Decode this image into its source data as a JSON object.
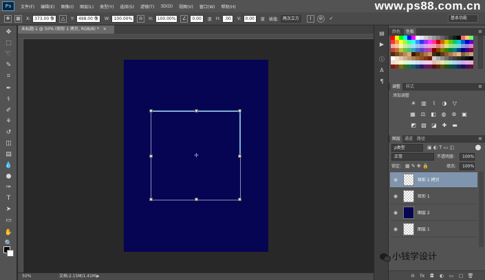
{
  "app": {
    "logo": "Ps",
    "menu": [
      "文件(F)",
      "编辑(E)",
      "图像(I)",
      "图层(L)",
      "类型(Y)",
      "选择(S)",
      "滤镜(T)",
      "3D(D)",
      "视图(V)",
      "窗口(W)",
      "帮助(H)"
    ],
    "watermark": "www.ps88.com.cn"
  },
  "options": {
    "x_label": "X:",
    "x_value": "373.00 像",
    "y_label": "Y:",
    "y_value": "498.00 像",
    "w_label": "W:",
    "w_value": "100.00%",
    "h_label": "H:",
    "h_value": "100.00%",
    "angle_value": "0.00",
    "angle_unit": "度",
    "hskew_label": "H:",
    "hskew_value": ".00",
    "vskew_label": "V:",
    "vskew_value": "0.00",
    "skew_unit": "度",
    "interp_label": "插值:",
    "interp_value": "两次立方",
    "cancel_icon": "cancel-icon",
    "commit_icon": "check-icon",
    "preset": "基本功能"
  },
  "document": {
    "tab_title": "未标题-1 @ 50% (矩形 1 拷贝, RGB/8) *",
    "tab_close": "×",
    "canvas_color": "#060553",
    "zoom": "50%",
    "doc_info": "文档:2.15M/1.41M",
    "status_arrow": "▶"
  },
  "tools": [
    "move-tool",
    "marquee-tool",
    "lasso-tool",
    "quick-select-tool",
    "crop-tool",
    "eyedropper-tool",
    "healing-brush-tool",
    "brush-tool",
    "clone-stamp-tool",
    "history-brush-tool",
    "eraser-tool",
    "gradient-tool",
    "blur-tool",
    "dodge-tool",
    "pen-tool",
    "type-tool",
    "path-select-tool",
    "rectangle-tool",
    "hand-tool",
    "zoom-tool"
  ],
  "tool_glyphs": [
    "✥",
    "⬚",
    "➰",
    "✎",
    "⌗",
    "✒",
    "⚕",
    "✐",
    "⚘",
    "↺",
    "◫",
    "▤",
    "💧",
    "●",
    "✑",
    "T",
    "➤",
    "▭",
    "✋",
    "🔍"
  ],
  "swatches_panel": {
    "tabs": [
      "颜色",
      "色板"
    ],
    "active": 1,
    "colors": [
      "#ff0000",
      "#ffff00",
      "#00ff00",
      "#00ffff",
      "#0000ff",
      "#ff00ff",
      "#ffffff",
      "#e6e6e6",
      "#cccccc",
      "#b3b3b3",
      "#999999",
      "#808080",
      "#666666",
      "#4d4d4d",
      "#333333",
      "#1a1a1a",
      "#000000",
      "#ff6666",
      "#ffcc66",
      "#66ff66",
      "#ff3333",
      "#ff9933",
      "#ffff33",
      "#99ff33",
      "#33ff99",
      "#33ffff",
      "#3399ff",
      "#3333ff",
      "#9933ff",
      "#ff33ff",
      "#ff3399",
      "#cc0000",
      "#cc6600",
      "#cccc00",
      "#66cc00",
      "#00cc66",
      "#00cccc",
      "#0066cc",
      "#0000cc",
      "#6600cc",
      "#f4a6a6",
      "#f7c6a0",
      "#faf3a0",
      "#c8eba0",
      "#a0e6c0",
      "#a0e0f0",
      "#a0c0f0",
      "#b0a0f0",
      "#d8a0f0",
      "#f0a0d8",
      "#f0a0b0",
      "#e08080",
      "#e0b080",
      "#e0e080",
      "#a0e080",
      "#80e0b0",
      "#80d0e0",
      "#80a0e0",
      "#a080e0",
      "#e080c0",
      "#c04040",
      "#c07040",
      "#c0c040",
      "#70c040",
      "#40c080",
      "#40a0c0",
      "#4070c0",
      "#6040c0",
      "#a040c0",
      "#c04090",
      "#800000",
      "#804000",
      "#808000",
      "#408000",
      "#008040",
      "#008080",
      "#004080",
      "#000080",
      "#400080",
      "#800040",
      "#5a2a00",
      "#7a4a1a",
      "#9a6a3a",
      "#ba8a5a",
      "#d8aa7a",
      "#3a1a00",
      "#6a3a10",
      "#8a5a2a",
      "#aa7a4a",
      "#c89a6a",
      "#4a2a10",
      "#2a1a0a",
      "#603818",
      "#905830",
      "#b07848",
      "#d09868",
      "#e8b888",
      "#806040",
      "#a08060",
      "#c0a080",
      "#ffffff",
      "#f0e0d0",
      "#e0c8b0",
      "#d0b090",
      "#c09870",
      "#b08050",
      "#a06838",
      "#905020",
      "#803810",
      "#702000",
      "#cfcfcf",
      "#b0b0b0",
      "#909090",
      "#707070",
      "#505050",
      "#404040",
      "#303030",
      "#202020",
      "#101010",
      "#000000",
      "#f8d8d8",
      "#f8e8d0",
      "#f8f8d0",
      "#e0f8d0",
      "#d0f8e8",
      "#d0f0f8",
      "#d0e0f8",
      "#e0d0f8",
      "#f0d0f8",
      "#f8d0e8",
      "#e8b8b8",
      "#e8d0b0",
      "#e8e8b0",
      "#c8e8b0",
      "#b0e8d0",
      "#b0d8e8",
      "#b0c8e8",
      "#c8b0e8",
      "#e0b0e8",
      "#e8b0d0",
      "#7a1a1a",
      "#7a3a1a",
      "#7a6a1a",
      "#3a6a1a",
      "#1a6a4a",
      "#1a5a6a",
      "#1a3a6a",
      "#2a1a6a",
      "#5a1a6a",
      "#6a1a4a",
      "#5a1010",
      "#5a2810",
      "#5a5010",
      "#285010",
      "#10503a",
      "#10445a",
      "#102a5a",
      "#20105a",
      "#42105a",
      "#5a1036"
    ]
  },
  "adjustments_panel": {
    "tabs": [
      "调整",
      "样式"
    ],
    "active": 0,
    "title": "添加调整",
    "rows": [
      [
        "brightness-icon",
        "levels-icon",
        "curves-icon",
        "exposure-icon",
        "vibrance-icon"
      ],
      [
        "hue-saturation-icon",
        "color-balance-icon",
        "black-white-icon",
        "photo-filter-icon",
        "channel-mixer-icon",
        "color-lookup-icon"
      ],
      [
        "invert-icon",
        "posterize-icon",
        "threshold-icon",
        "selective-color-icon",
        "gradient-map-icon"
      ]
    ],
    "glyphs": [
      [
        "☀",
        "▥",
        "⌇",
        "◑",
        "▽"
      ],
      [
        "▦",
        "⚖",
        "◧",
        "◍",
        "⊛",
        "▣"
      ],
      [
        "◩",
        "▧",
        "◪",
        "✚",
        "▬"
      ]
    ]
  },
  "layers_panel": {
    "tabs": [
      "图层",
      "通道",
      "路径"
    ],
    "active": 0,
    "filter_type": "ρ类型",
    "blend_mode": "正常",
    "opacity_label": "不透明度:",
    "opacity_value": "100%",
    "lock_label": "锁定:",
    "fill_label": "填充:",
    "fill_value": "100%",
    "layers": [
      {
        "name": "矩形 1 拷贝",
        "thumb": "checker",
        "selected": true,
        "visible": true
      },
      {
        "name": "矩形 1",
        "thumb": "checker",
        "selected": false,
        "visible": true
      },
      {
        "name": "图层 2",
        "thumb": "navy",
        "selected": false,
        "visible": true
      },
      {
        "name": "图层 1",
        "thumb": "checker",
        "selected": false,
        "visible": true
      }
    ],
    "footer_icons": [
      "link-icon",
      "fx-icon",
      "mask-icon",
      "adjustment-icon",
      "group-icon",
      "new-layer-icon",
      "trash-icon"
    ],
    "footer_glyphs": [
      "⊝",
      "fx",
      "◘",
      "◐",
      "▭",
      "▢",
      "🗑"
    ]
  },
  "branding": {
    "label": "小钱学设计"
  }
}
